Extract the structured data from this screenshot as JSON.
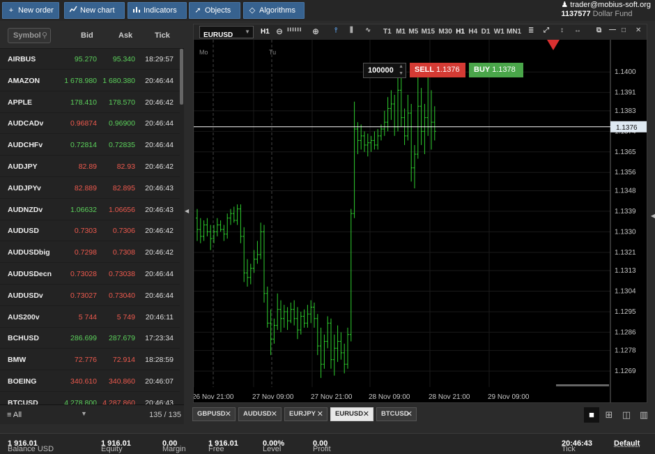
{
  "toolbar": {
    "new_order": "New order",
    "new_chart": "New chart",
    "indicators": "Indicators",
    "objects": "Objects",
    "algorithms": "Algorithms"
  },
  "account": {
    "user": "trader@mobius-soft.org",
    "number": "1137577",
    "name": "Dollar Fund"
  },
  "watchlist": {
    "search_placeholder": "Symbol",
    "headers": {
      "bid": "Bid",
      "ask": "Ask",
      "tick": "Tick"
    },
    "rows": [
      {
        "symbol": "AIRBUS",
        "bid": "95.270",
        "ask": "95.340",
        "tick": "18:29:57",
        "dir": "up"
      },
      {
        "symbol": "AMAZON",
        "bid": "1 678.980",
        "ask": "1 680.380",
        "tick": "20:46:44",
        "dir": "up"
      },
      {
        "symbol": "APPLE",
        "bid": "178.410",
        "ask": "178.570",
        "tick": "20:46:42",
        "dir": "up"
      },
      {
        "symbol": "AUDCADv",
        "bid": "0.96874",
        "ask": "0.96900",
        "tick": "20:46:44",
        "dir": "mixed"
      },
      {
        "symbol": "AUDCHFv",
        "bid": "0.72814",
        "ask": "0.72835",
        "tick": "20:46:44",
        "dir": "up"
      },
      {
        "symbol": "AUDJPY",
        "bid": "82.89",
        "ask": "82.93",
        "tick": "20:46:42",
        "dir": "down"
      },
      {
        "symbol": "AUDJPYv",
        "bid": "82.889",
        "ask": "82.895",
        "tick": "20:46:43",
        "dir": "down"
      },
      {
        "symbol": "AUDNZDv",
        "bid": "1.06632",
        "ask": "1.06656",
        "tick": "20:46:43",
        "dir": "up-down"
      },
      {
        "symbol": "AUDUSD",
        "bid": "0.7303",
        "ask": "0.7306",
        "tick": "20:46:42",
        "dir": "down"
      },
      {
        "symbol": "AUDUSDbig",
        "bid": "0.7298",
        "ask": "0.7308",
        "tick": "20:46:42",
        "dir": "down"
      },
      {
        "symbol": "AUDUSDecn",
        "bid": "0.73028",
        "ask": "0.73038",
        "tick": "20:46:44",
        "dir": "down"
      },
      {
        "symbol": "AUDUSDv",
        "bid": "0.73027",
        "ask": "0.73040",
        "tick": "20:46:44",
        "dir": "down"
      },
      {
        "symbol": "AUS200v",
        "bid": "5 744",
        "ask": "5 749",
        "tick": "20:46:11",
        "dir": "down"
      },
      {
        "symbol": "BCHUSD",
        "bid": "286.699",
        "ask": "287.679",
        "tick": "17:23:34",
        "dir": "up"
      },
      {
        "symbol": "BMW",
        "bid": "72.776",
        "ask": "72.914",
        "tick": "18:28:59",
        "dir": "down"
      },
      {
        "symbol": "BOEING",
        "bid": "340.610",
        "ask": "340.860",
        "tick": "20:46:07",
        "dir": "down"
      },
      {
        "symbol": "BTCUSD",
        "bid": "4 278.800",
        "ask": "4 287.860",
        "tick": "20:46:43",
        "dir": "up-down"
      }
    ],
    "filter": "All",
    "count": "135 / 135"
  },
  "chart": {
    "symbol": "EURUSD",
    "timeframe": "H1",
    "timeframes": [
      "T1",
      "M1",
      "M5",
      "M15",
      "M30",
      "H1",
      "H4",
      "D1",
      "W1",
      "MN1"
    ],
    "volume": "100000",
    "sell_label": "SELL",
    "sell_price": "1.1376",
    "buy_label": "BUY",
    "buy_price": "1.1378",
    "day_labels": [
      "Mo",
      "Tu"
    ],
    "current_price_label": "1.1376",
    "colors": {
      "bar": "#2fd12f",
      "current_line": "#ffffff",
      "sell": "#d43b34",
      "buy": "#4aa64a"
    }
  },
  "chart_data": {
    "type": "ohlc",
    "title": "",
    "x_ticks": [
      "26 Nov 21:00",
      "27 Nov 09:00",
      "27 Nov 21:00",
      "28 Nov 09:00",
      "28 Nov 21:00",
      "29 Nov 09:00"
    ],
    "y_ticks": [
      "1.1400",
      "1.1391",
      "1.1383",
      "1.1374",
      "1.1365",
      "1.1356",
      "1.1348",
      "1.1339",
      "1.1330",
      "1.1321",
      "1.1313",
      "1.1304",
      "1.1295",
      "1.1286",
      "1.1278",
      "1.1269"
    ],
    "ylim": [
      1.1262,
      1.1408
    ],
    "current_price": 1.1376,
    "grid": true,
    "series": [
      {
        "values": [
          [
            1.1336,
            1.134,
            1.1326,
            1.1331
          ],
          [
            1.1331,
            1.1336,
            1.1325,
            1.1328
          ],
          [
            1.1328,
            1.1335,
            1.1326,
            1.1333
          ],
          [
            1.1333,
            1.1336,
            1.1328,
            1.133
          ],
          [
            1.133,
            1.1333,
            1.1322,
            1.1327
          ],
          [
            1.1327,
            1.1333,
            1.1325,
            1.133
          ],
          [
            1.133,
            1.1336,
            1.1328,
            1.1333
          ],
          [
            1.1333,
            1.1335,
            1.133,
            1.1331
          ],
          [
            1.1331,
            1.1333,
            1.1326,
            1.1329
          ],
          [
            1.1329,
            1.1338,
            1.1327,
            1.1336
          ],
          [
            1.1336,
            1.134,
            1.1333,
            1.1338
          ],
          [
            1.1338,
            1.1341,
            1.1334,
            1.1335
          ],
          [
            1.1335,
            1.1342,
            1.1333,
            1.134
          ],
          [
            1.134,
            1.1342,
            1.1325,
            1.1328
          ],
          [
            1.1328,
            1.1332,
            1.1308,
            1.1312
          ],
          [
            1.1312,
            1.1318,
            1.1306,
            1.131
          ],
          [
            1.131,
            1.1316,
            1.1307,
            1.1314
          ],
          [
            1.1314,
            1.1322,
            1.1312,
            1.1318
          ],
          [
            1.1318,
            1.1326,
            1.1316,
            1.132
          ],
          [
            1.132,
            1.1334,
            1.1318,
            1.133
          ],
          [
            1.133,
            1.1333,
            1.1299,
            1.1303
          ],
          [
            1.1303,
            1.1306,
            1.1288,
            1.129
          ],
          [
            1.129,
            1.1296,
            1.1276,
            1.1283
          ],
          [
            1.1283,
            1.1292,
            1.1281,
            1.1289
          ],
          [
            1.1289,
            1.1303,
            1.1287,
            1.1296
          ],
          [
            1.1296,
            1.13,
            1.1286,
            1.1292
          ],
          [
            1.1292,
            1.1298,
            1.1288,
            1.1295
          ],
          [
            1.1295,
            1.1297,
            1.1287,
            1.1291
          ],
          [
            1.1291,
            1.1299,
            1.129,
            1.1296
          ],
          [
            1.1296,
            1.13,
            1.1289,
            1.1292
          ],
          [
            1.1292,
            1.1297,
            1.1283,
            1.1287
          ],
          [
            1.1287,
            1.1295,
            1.1285,
            1.1293
          ],
          [
            1.1293,
            1.1296,
            1.1288,
            1.129
          ],
          [
            1.129,
            1.1298,
            1.1288,
            1.1294
          ],
          [
            1.1294,
            1.13,
            1.129,
            1.1297
          ],
          [
            1.1297,
            1.1299,
            1.1288,
            1.1292
          ],
          [
            1.1292,
            1.1294,
            1.1276,
            1.128
          ],
          [
            1.128,
            1.1288,
            1.1266,
            1.1272
          ],
          [
            1.1272,
            1.1285,
            1.127,
            1.1282
          ],
          [
            1.1282,
            1.1293,
            1.1279,
            1.129
          ],
          [
            1.129,
            1.1292,
            1.127,
            1.1274
          ],
          [
            1.1274,
            1.1285,
            1.1267,
            1.1279
          ],
          [
            1.1279,
            1.1289,
            1.1273,
            1.1282
          ],
          [
            1.1282,
            1.1286,
            1.1274,
            1.1277
          ],
          [
            1.1277,
            1.1281,
            1.1268,
            1.1272
          ],
          [
            1.1272,
            1.1288,
            1.127,
            1.1285
          ],
          [
            1.1285,
            1.134,
            1.1282,
            1.1338
          ],
          [
            1.1338,
            1.1387,
            1.1336,
            1.1375
          ],
          [
            1.1375,
            1.1378,
            1.1364,
            1.137
          ],
          [
            1.137,
            1.1377,
            1.1366,
            1.1372
          ],
          [
            1.1372,
            1.1374,
            1.1365,
            1.1368
          ],
          [
            1.1368,
            1.1373,
            1.1363,
            1.1369
          ],
          [
            1.1369,
            1.1372,
            1.1365,
            1.137
          ],
          [
            1.137,
            1.1374,
            1.1366,
            1.1368
          ],
          [
            1.1368,
            1.1375,
            1.1366,
            1.1372
          ],
          [
            1.1372,
            1.1377,
            1.137,
            1.1375
          ],
          [
            1.1375,
            1.1383,
            1.1372,
            1.1378
          ],
          [
            1.1378,
            1.1389,
            1.1374,
            1.1384
          ],
          [
            1.1384,
            1.1392,
            1.1379,
            1.1386
          ],
          [
            1.1386,
            1.139,
            1.1372,
            1.1376
          ],
          [
            1.1376,
            1.1398,
            1.1374,
            1.1392
          ],
          [
            1.1392,
            1.14,
            1.1376,
            1.138
          ],
          [
            1.138,
            1.1384,
            1.1368,
            1.1372
          ],
          [
            1.1372,
            1.139,
            1.137,
            1.1382
          ],
          [
            1.1382,
            1.1386,
            1.1352,
            1.1358
          ],
          [
            1.1358,
            1.1368,
            1.1349,
            1.1364
          ],
          [
            1.1364,
            1.1402,
            1.1362,
            1.1385
          ],
          [
            1.1385,
            1.1393,
            1.1368,
            1.1374
          ],
          [
            1.1374,
            1.1386,
            1.1364,
            1.138
          ],
          [
            1.138,
            1.1398,
            1.1372,
            1.1376
          ],
          [
            1.1376,
            1.1392,
            1.1366,
            1.1378
          ],
          [
            1.1378,
            1.1385,
            1.137,
            1.1374
          ]
        ]
      }
    ]
  },
  "tabs": [
    {
      "label": "GBPUSD",
      "active": false
    },
    {
      "label": "AUDUSD",
      "active": false
    },
    {
      "label": "EURJPY",
      "active": false
    },
    {
      "label": "EURUSD",
      "active": true
    },
    {
      "label": "BTCUSD",
      "active": false
    }
  ],
  "status": {
    "balance_label": "Balance",
    "balance": "1 916.01",
    "currency": "USD",
    "equity_label": "Equity",
    "equity": "1 916.01",
    "margin_label": "Margin",
    "margin": "0.00",
    "free_label": "Free",
    "free": "1 916.01",
    "level_label": "Level",
    "level": "0.00%",
    "profit_label": "Profit",
    "profit": "0.00",
    "tick_label": "Tick",
    "tick": "20:46:43",
    "profile": "Default"
  }
}
